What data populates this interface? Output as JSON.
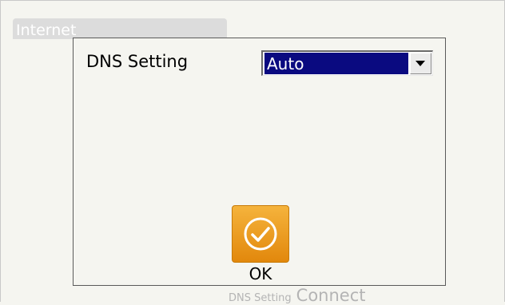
{
  "background": {
    "window_title": "Internet",
    "bottom_small_label": "DNS Setting",
    "bottom_large_label": "Connect"
  },
  "dialog": {
    "dns_label": "DNS Setting",
    "dns_select": {
      "selected_value": "Auto"
    },
    "ok_button": {
      "label": "OK",
      "icon": "checkmark-circle-icon",
      "color": "#f0a020"
    }
  }
}
